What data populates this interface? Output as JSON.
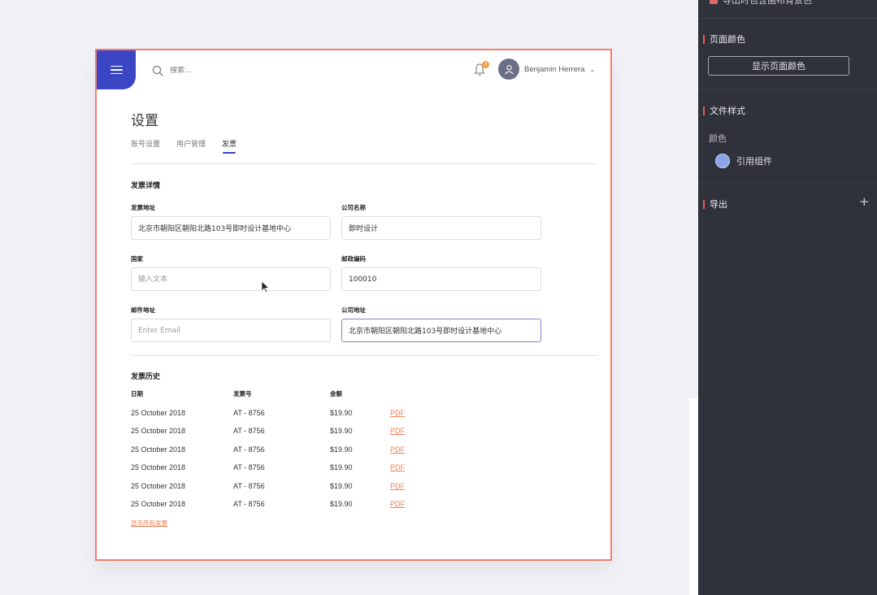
{
  "header": {
    "search_placeholder": "搜索...",
    "notification_count": "3",
    "user_name": "Benjamin Herrera",
    "user_caret": "⌄"
  },
  "page": {
    "title": "设置",
    "tabs": [
      {
        "label": "账号设置",
        "active": false
      },
      {
        "label": "用户管理",
        "active": false
      },
      {
        "label": "发票",
        "active": true
      }
    ]
  },
  "invoice_details": {
    "title": "发票详情",
    "fields": {
      "billing_address": {
        "label": "发票地址",
        "value": "北京市朝阳区朝阳北路103号即时设计基地中心",
        "placeholder": ""
      },
      "company_name": {
        "label": "公司名称",
        "value": "即时设计",
        "placeholder": ""
      },
      "country": {
        "label": "国家",
        "value": "",
        "placeholder": "输入文本"
      },
      "postal_code": {
        "label": "邮政编码",
        "value": "100010",
        "placeholder": ""
      },
      "email": {
        "label": "邮件地址",
        "value": "",
        "placeholder": "Enter Email"
      },
      "company_address": {
        "label": "公司地址",
        "value": "北京市朝阳区朝阳北路103号即时设计基地中心",
        "placeholder": ""
      }
    }
  },
  "invoice_history": {
    "title": "发票历史",
    "columns": [
      "日期",
      "发票号",
      "金额"
    ],
    "rows": [
      {
        "date": "25 October 2018",
        "number": "AT - 8756",
        "amount": "$19.90",
        "link": "PDF"
      },
      {
        "date": "25 October 2018",
        "number": "AT - 8756",
        "amount": "$19.90",
        "link": "PDF"
      },
      {
        "date": "25 October 2018",
        "number": "AT - 8756",
        "amount": "$19.90",
        "link": "PDF"
      },
      {
        "date": "25 October 2018",
        "number": "AT - 8756",
        "amount": "$19.90",
        "link": "PDF"
      },
      {
        "date": "25 October 2018",
        "number": "AT - 8756",
        "amount": "$19.90",
        "link": "PDF"
      },
      {
        "date": "25 October 2018",
        "number": "AT - 8756",
        "amount": "$19.90",
        "link": "PDF"
      }
    ],
    "show_all": "显示所有发票"
  },
  "panel": {
    "top_strip_text": "导出时包含画布背景色",
    "page_color": {
      "title": "页面颜色",
      "button": "显示页面颜色"
    },
    "file_style": {
      "title": "文件样式",
      "sub": "颜色",
      "color_name": "引用组件",
      "color": "#8aa4ea"
    },
    "export": {
      "title": "导出",
      "plus": "+"
    }
  },
  "colors": {
    "accent": "#3a46c3",
    "link": "#f07d50",
    "selection": "#f07d72",
    "panel_bg": "#2f313b"
  }
}
